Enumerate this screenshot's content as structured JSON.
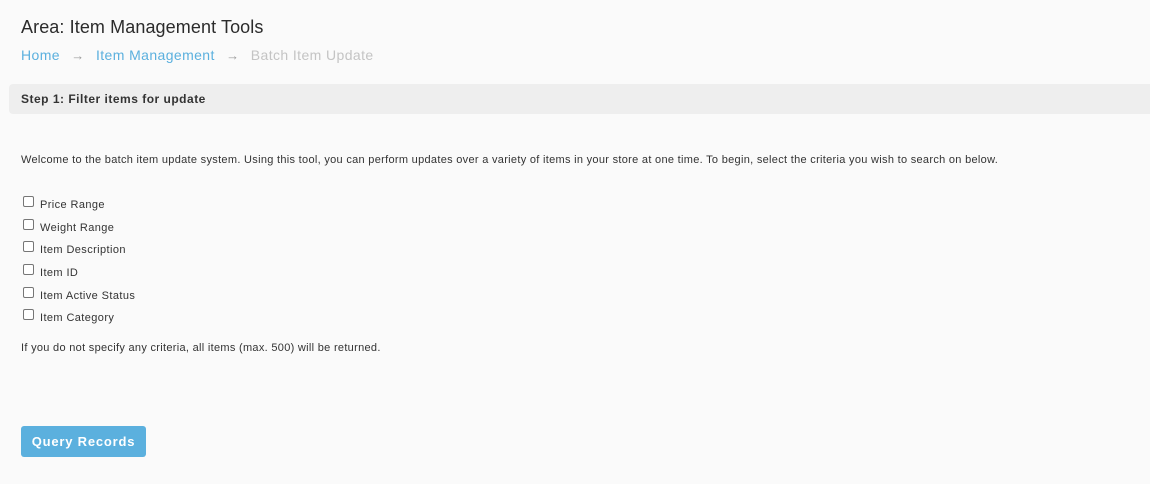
{
  "area_title": "Area: Item Management Tools",
  "breadcrumb": {
    "home": "Home",
    "separator": "→",
    "item_management": "Item Management",
    "current": "Batch Item Update"
  },
  "step": {
    "title": "Step 1: Filter items for update"
  },
  "intro_text": "Welcome to the batch item update system. Using this tool, you can perform updates over a variety of items in your store at one time. To begin, select the criteria you wish to search on below.",
  "criteria": [
    {
      "label": "Price Range",
      "checked": false
    },
    {
      "label": "Weight Range",
      "checked": false
    },
    {
      "label": "Item Description",
      "checked": false
    },
    {
      "label": "Item ID",
      "checked": false
    },
    {
      "label": "Item Active Status",
      "checked": false
    },
    {
      "label": "Item Category",
      "checked": false
    }
  ],
  "note_text": "If you do not specify any criteria, all items (max. 500) will be returned.",
  "query_button_label": "Query Records",
  "colors": {
    "accent": "#5bb0de",
    "breadcrumb_current": "#c4c4c4",
    "step_header_bg": "#eeeeee",
    "page_bg": "#fafafa"
  }
}
